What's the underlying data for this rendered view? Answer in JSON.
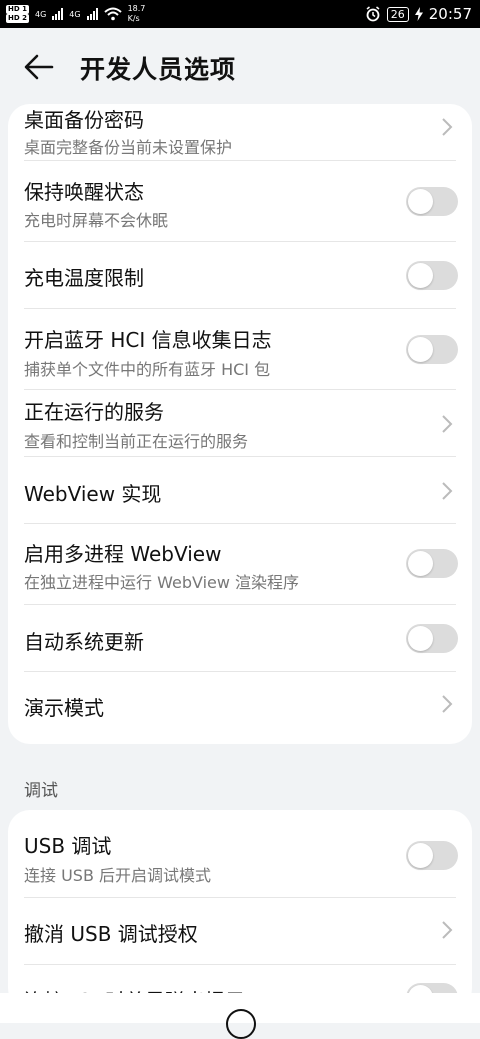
{
  "status_bar": {
    "hd1": "HD 1",
    "hd2": "HD 2",
    "sim1_type": "4G",
    "sim2_type": "4G",
    "speed_value": "18.7",
    "speed_unit": "K/s",
    "battery": "26",
    "time": "20:57"
  },
  "header": {
    "title": "开发人员选项"
  },
  "settings": [
    {
      "title": "桌面备份密码",
      "subtitle": "桌面完整备份当前未设置保护",
      "control": "chevron"
    },
    {
      "title": "保持唤醒状态",
      "subtitle": "充电时屏幕不会休眠",
      "control": "toggle",
      "on": false
    },
    {
      "title": "充电温度限制",
      "subtitle": "",
      "control": "toggle",
      "on": false
    },
    {
      "title": "开启蓝牙 HCI 信息收集日志",
      "subtitle": "捕获单个文件中的所有蓝牙 HCI 包",
      "control": "toggle",
      "on": false
    },
    {
      "title": "正在运行的服务",
      "subtitle": "查看和控制当前正在运行的服务",
      "control": "chevron"
    },
    {
      "title": "WebView 实现",
      "subtitle": "",
      "control": "chevron"
    },
    {
      "title": "启用多进程 WebView",
      "subtitle": "在独立进程中运行 WebView 渲染程序",
      "control": "toggle",
      "on": false
    },
    {
      "title": "自动系统更新",
      "subtitle": "",
      "control": "toggle",
      "on": false
    },
    {
      "title": "演示模式",
      "subtitle": "",
      "control": "chevron"
    }
  ],
  "debug_section": {
    "label": "调试",
    "items": [
      {
        "title": "USB 调试",
        "subtitle": "连接 USB 后开启调试模式",
        "control": "toggle",
        "on": false
      },
      {
        "title": "撤消 USB 调试授权",
        "subtitle": "",
        "control": "chevron"
      },
      {
        "title": "连接USB时总是弹出提示",
        "subtitle": "",
        "control": "toggle",
        "on": false
      }
    ]
  },
  "colors": {
    "toggle_off": "#dcdcdc",
    "background": "#f1f3f5",
    "card": "#ffffff"
  }
}
